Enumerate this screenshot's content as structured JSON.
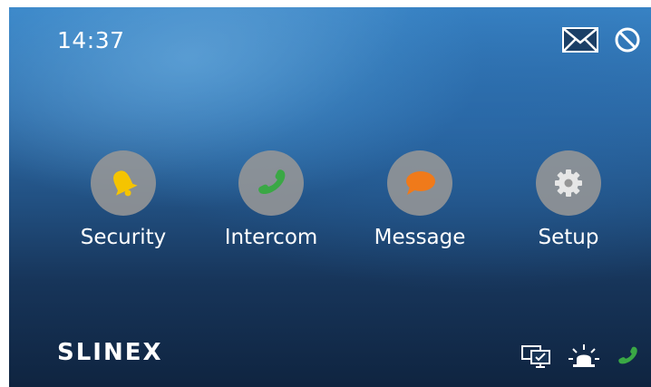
{
  "status_bar": {
    "time": "14:37",
    "icons": [
      "mail-icon",
      "do-not-disturb-icon"
    ]
  },
  "main_menu": {
    "items": [
      {
        "label": "Security",
        "icon": "bell-icon",
        "icon_color": "#f5c400"
      },
      {
        "label": "Intercom",
        "icon": "phone-icon",
        "icon_color": "#3aa845"
      },
      {
        "label": "Message",
        "icon": "speech-bubble-icon",
        "icon_color": "#f07a1a"
      },
      {
        "label": "Setup",
        "icon": "gear-icon",
        "icon_color": "#e6e6e6"
      }
    ]
  },
  "footer": {
    "brand": "SLINEX",
    "icons": [
      "monitors-icon",
      "alarm-light-icon",
      "phone-handset-icon"
    ],
    "phone_color": "#3aa845"
  },
  "colors": {
    "circle_bg": "#969696",
    "text": "#ffffff"
  }
}
